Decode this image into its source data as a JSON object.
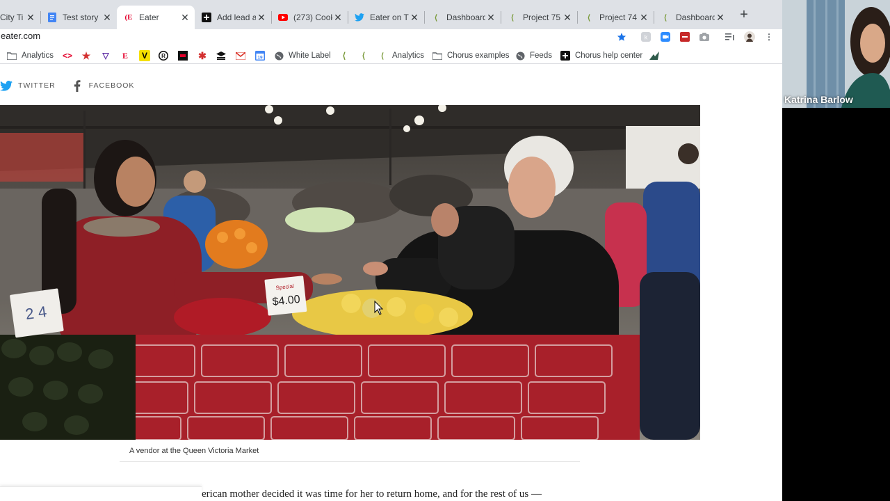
{
  "browser": {
    "tabs": [
      {
        "title": "City Ti",
        "favicon": "page-icon",
        "active": false
      },
      {
        "title": "Test story",
        "favicon": "docs-icon",
        "active": false
      },
      {
        "title": "Eater",
        "favicon": "eater-icon",
        "active": true
      },
      {
        "title": "Add lead a",
        "favicon": "plus-square-icon",
        "active": false
      },
      {
        "title": "(273) Cook",
        "favicon": "youtube-icon",
        "active": false
      },
      {
        "title": "Eater on T",
        "favicon": "twitter-icon",
        "active": false
      },
      {
        "title": "Dashboard",
        "favicon": "chorus-icon",
        "active": false
      },
      {
        "title": "Project 75",
        "favicon": "chorus-icon",
        "active": false
      },
      {
        "title": "Project 74",
        "favicon": "chorus-icon",
        "active": false
      },
      {
        "title": "Dashboard",
        "favicon": "chorus-icon",
        "active": false
      }
    ],
    "url": "eater.com",
    "bookmarks": {
      "analytics_1": "Analytics",
      "white_label": "White Label",
      "analytics_2": "Analytics",
      "chorus_examples": "Chorus examples",
      "feeds": "Feeds",
      "chorus_help_center": "Chorus help center",
      "calendar_day": "19"
    }
  },
  "page": {
    "share": {
      "twitter": "TWITTER",
      "facebook": "FACEBOOK"
    },
    "photo": {
      "price_sign": "$4.00",
      "price_sign_top": "Special",
      "small_sign": "2 4"
    },
    "caption": "A vendor at the Queen Victoria Market",
    "body_text": "erican mother decided it was time for her to return home, and for the rest of us —"
  },
  "videocall": {
    "participant_name": "Katrina Barlow"
  },
  "colors": {
    "tabstrip": "#dee1e6",
    "twitter_blue": "#1da1f2",
    "eater_red": "#e4002b",
    "star_blue": "#1a73e8"
  }
}
